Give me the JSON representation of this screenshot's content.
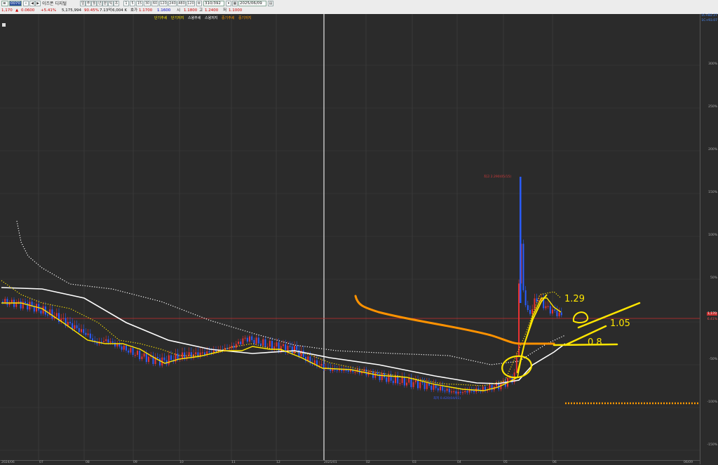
{
  "toolbar": {
    "code": "0070",
    "name": "이즈폰 디지털",
    "period_buttons": [
      "1",
      "5",
      "15",
      "30",
      "60",
      "120",
      "240",
      "480",
      "120"
    ],
    "count_value": "310/392",
    "date_value": "2025/06/09",
    "price": "1,170",
    "change": "0.0600",
    "change_pct": "+5.41%",
    "volume": "5,175,994",
    "volume_pct": "90.45%",
    "amount": "7.13억",
    "field1": "6,004 K",
    "label_ho": "호가",
    "ho_val": "1.1700",
    "ho_val2": "1.1600",
    "label_si": "시",
    "si_val": "1.1800",
    "label_go": "고",
    "go_val": "1.2400",
    "label_jeo": "저",
    "jeo_val": "1.1000"
  },
  "legend": [
    "단기추세",
    "단기저지",
    "스윙추세",
    "스윙저지",
    "중기추세",
    "중기저지"
  ],
  "legend_colors": [
    "#ffe600",
    "#ffe600",
    "#ffffff",
    "#ffffff",
    "#ff9900",
    "#ff9900"
  ],
  "yaxis": {
    "labels": [
      "300%",
      "250%",
      "200%",
      "150%",
      "100%",
      "50%",
      "0%",
      "-50%",
      "-100%",
      "-150%"
    ],
    "top_tags": [
      "1C+B2.27",
      "1C+93.07"
    ],
    "price_tag": "1,170",
    "price_pct": "6.41%"
  },
  "xaxis": {
    "labels": [
      "2024/06",
      "07",
      "08",
      "09",
      "10",
      "11",
      "12",
      "2025/01",
      "02",
      "03",
      "04",
      "05",
      "06",
      "06/09"
    ]
  },
  "annotations": {
    "high_label": "최고 2.290(05/15)",
    "low_label": "최저 0.420(04/01)",
    "hand_labels": [
      "1.29",
      "1.05",
      "0.8"
    ]
  },
  "colors": {
    "short": "#ffe600",
    "swing": "#ffffff",
    "mid": "#ff9900",
    "up": "#e83232",
    "down": "#2a5cff",
    "price_line": "#c83030"
  }
}
